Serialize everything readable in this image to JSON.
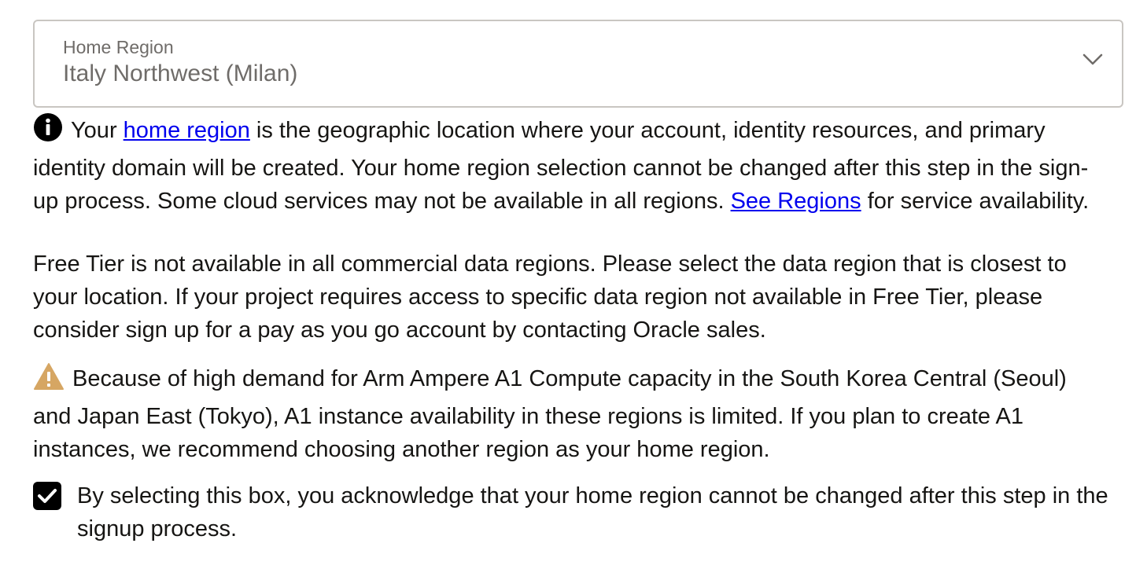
{
  "home_region": {
    "label": "Home Region",
    "value": "Italy Northwest (Milan)",
    "icon": "chevron-down-icon"
  },
  "info": {
    "icon": "info-icon",
    "text_1": "Your ",
    "link_home_region": "home region",
    "text_2": " is the geographic location where your account, identity resources, and primary identity domain will be created. Your home region selection cannot be changed after this step in the sign-up process. Some cloud services may not be available in all regions. ",
    "link_see_regions": "See Regions",
    "text_3": " for service availability."
  },
  "free_tier": {
    "text": "Free Tier is not available in all commercial data regions. Please select the data region that is closest to your location. If your project requires access to specific data region not available in Free Tier, please consider sign up for a pay as you go account by contacting Oracle sales."
  },
  "warning": {
    "icon": "warning-icon",
    "icon_color": "#d6a663",
    "text": "Because of high demand for Arm Ampere A1 Compute capacity in the South Korea Central (Seoul) and Japan East (Tokyo), A1 instance availability in these regions is limited. If you plan to create A1 instances, we recommend choosing another region as your home region."
  },
  "acknowledge": {
    "checked": true,
    "text": "By selecting this box, you acknowledge that your home region cannot be changed after this step in the signup process."
  },
  "colors": {
    "link": "#0000ee",
    "text": "#161513",
    "muted": "#6f6c69",
    "border": "#c9c6c2"
  }
}
